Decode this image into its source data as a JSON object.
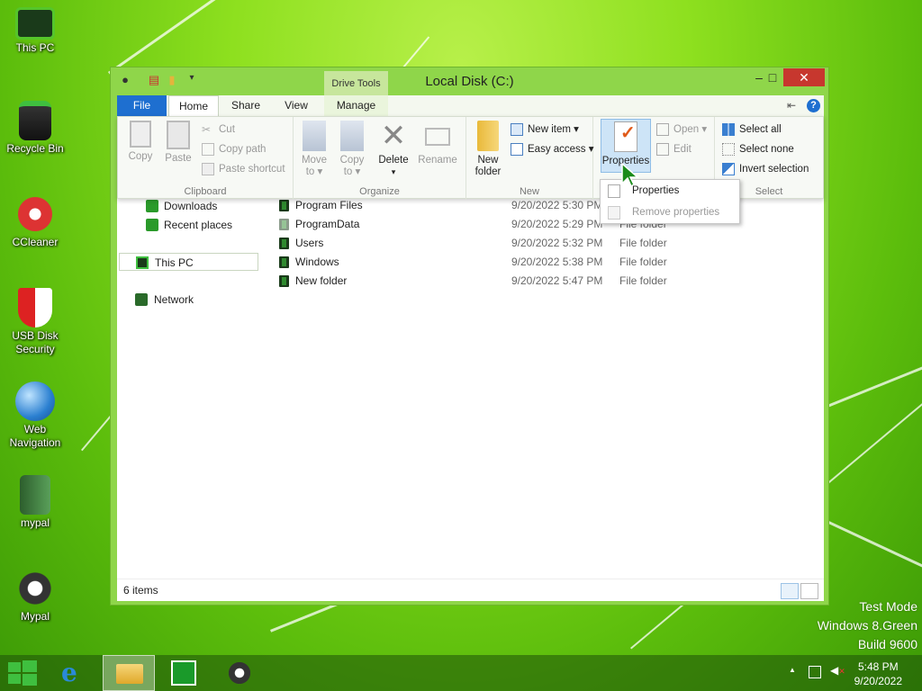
{
  "desktop": {
    "icons": [
      {
        "label": "This PC"
      },
      {
        "label": "Recycle Bin"
      },
      {
        "label": "CCleaner"
      },
      {
        "label": "USB Disk Security"
      },
      {
        "label": "Web Navigation"
      },
      {
        "label": "mypal"
      },
      {
        "label": "Mypal"
      }
    ],
    "watermark": [
      "Test Mode",
      "Windows 8.Green",
      "Build 9600"
    ]
  },
  "window": {
    "title": "Local Disk (C:)",
    "context_tab_title": "Drive Tools",
    "minimize": "–",
    "maximize": "□",
    "close": "✕",
    "tabs": [
      "File",
      "Home",
      "Share",
      "View",
      "Manage"
    ],
    "active_tab": "Home",
    "help": "?",
    "ribbon": {
      "clipboard": {
        "label": "Clipboard",
        "copy": "Copy",
        "paste": "Paste",
        "cut": "Cut",
        "copy_path": "Copy path",
        "paste_shortcut": "Paste shortcut"
      },
      "organize": {
        "label": "Organize",
        "move_to": [
          "Move",
          "to ▾"
        ],
        "copy_to": [
          "Copy",
          "to ▾"
        ],
        "delete": [
          "Delete",
          "▾"
        ],
        "rename": "Rename"
      },
      "new": {
        "label": "New",
        "new_folder": [
          "New",
          "folder"
        ],
        "new_item": "New item ▾",
        "easy_access": "Easy access ▾"
      },
      "open": {
        "properties": "Properties",
        "open": "Open ▾",
        "edit": "Edit"
      },
      "select": {
        "label": "Select",
        "select_all": "Select all",
        "select_none": "Select none",
        "invert_selection": "Invert selection"
      }
    },
    "properties_menu": {
      "items": [
        {
          "label": "Properties",
          "enabled": true
        },
        {
          "label": "Remove properties",
          "enabled": false
        }
      ]
    },
    "nav": {
      "items": [
        "Downloads",
        "Recent places",
        "This PC",
        "Network"
      ]
    },
    "files": [
      {
        "name": "Program Files",
        "date": "9/20/2022 5:30 PM",
        "type": "File folder"
      },
      {
        "name": "ProgramData",
        "date": "9/20/2022 5:29 PM",
        "type": "File folder"
      },
      {
        "name": "Users",
        "date": "9/20/2022 5:32 PM",
        "type": "File folder"
      },
      {
        "name": "Windows",
        "date": "9/20/2022 5:38 PM",
        "type": "File folder"
      },
      {
        "name": "New folder",
        "date": "9/20/2022 5:47 PM",
        "type": "File folder"
      }
    ],
    "status": "6 items"
  },
  "taskbar": {
    "time": "5:48 PM",
    "date": "9/20/2022",
    "tray_arrow": "▲"
  },
  "colors": {
    "accent": "#1e6fd0",
    "frame": "#8fd64a",
    "close": "#c7372e"
  }
}
